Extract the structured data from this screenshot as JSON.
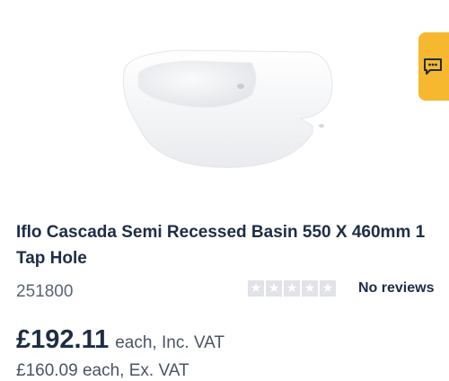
{
  "product": {
    "title": "Iflo Cascada Semi Recessed Basin 550 X 460mm 1 Tap Hole",
    "code": "251800",
    "reviews_text": "No reviews",
    "rating": 0,
    "rating_max": 5,
    "price": "£192.11",
    "price_suffix": "each, Inc. VAT",
    "price_ex_vat": "£160.09 each, Ex. VAT"
  },
  "icons": {
    "chat": "chat-bubble-icon",
    "star": "star-icon"
  },
  "colors": {
    "chat_button": "#f5b82e",
    "text_primary": "#1e2d45",
    "star_empty": "#e1e3e8"
  }
}
